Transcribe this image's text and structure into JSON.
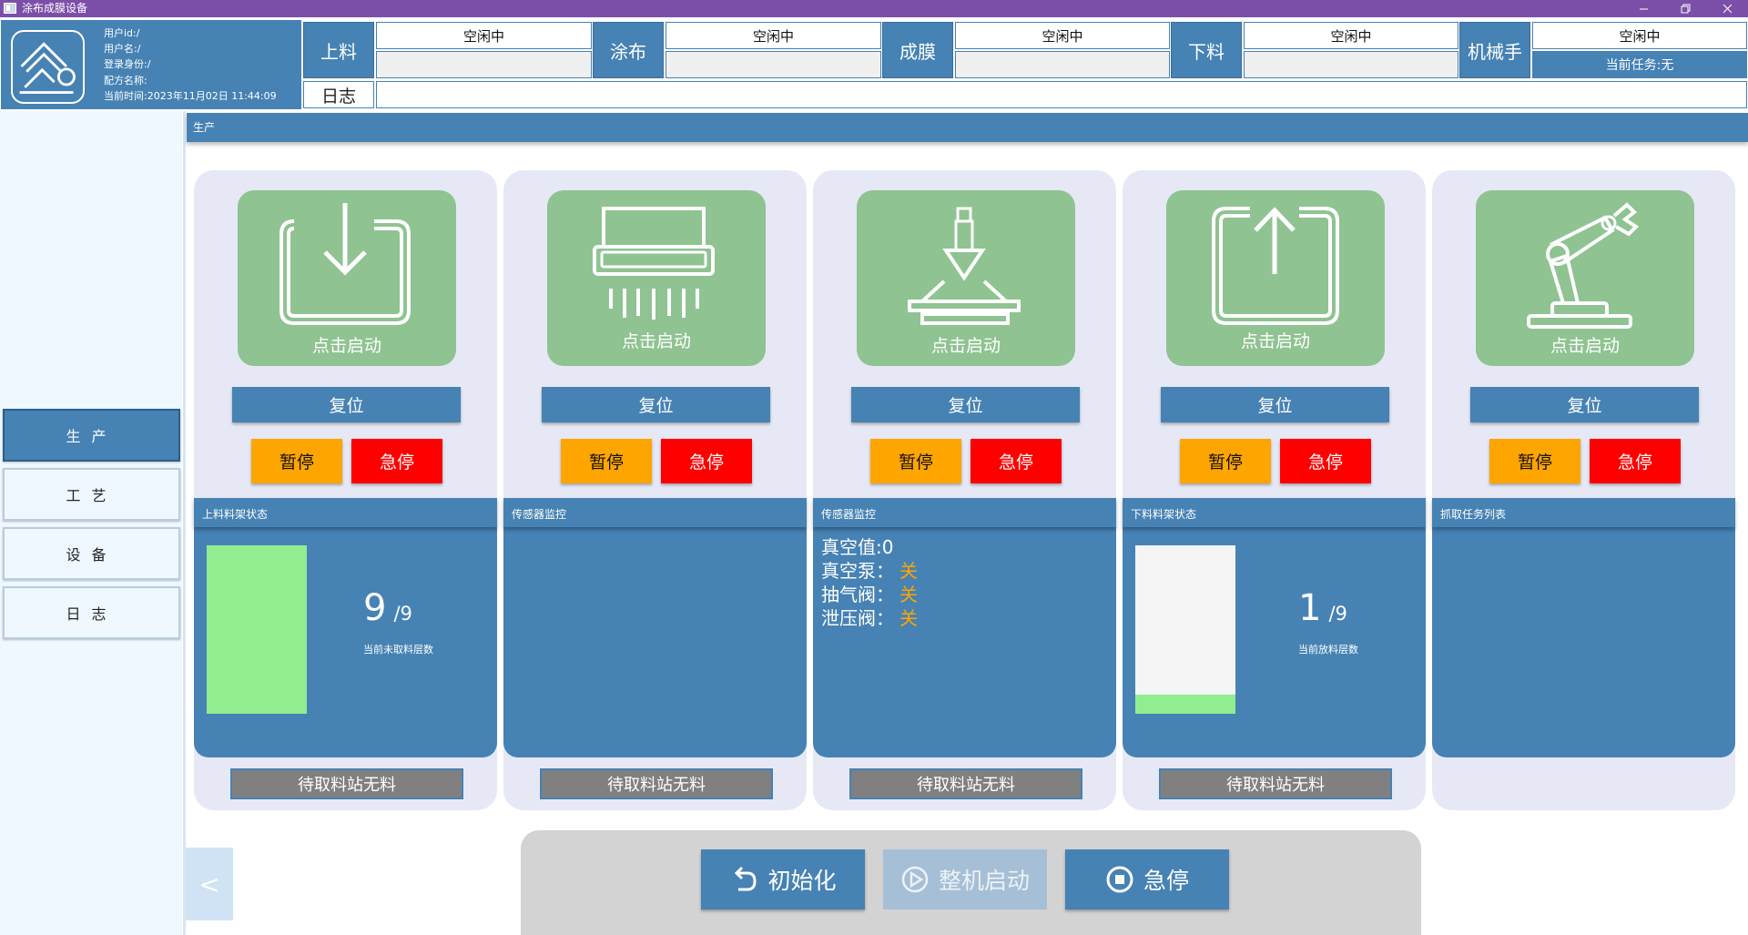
{
  "window": {
    "title": "涂布成膜设备",
    "controls": [
      "minimize-icon",
      "restore-icon",
      "close-icon"
    ]
  },
  "user": {
    "id": "用户id:/",
    "name": "用户名:/",
    "role": "登录身份:/",
    "recipe": "配方名称:",
    "time": "当前时间:2023年11月02日 11:44:09"
  },
  "stations": [
    {
      "label": "上料",
      "status": "空闲中",
      "sub": ""
    },
    {
      "label": "涂布",
      "status": "空闲中",
      "sub": ""
    },
    {
      "label": "成膜",
      "status": "空闲中",
      "sub": ""
    },
    {
      "label": "下料",
      "status": "空闲中",
      "sub": ""
    },
    {
      "label": "机械手",
      "status": "空闲中",
      "sub": "当前任务:无"
    }
  ],
  "log": {
    "label": "日志",
    "value": ""
  },
  "nav": [
    {
      "label": "生产",
      "active": true
    },
    {
      "label": "工艺",
      "active": false
    },
    {
      "label": "设备",
      "active": false
    },
    {
      "label": "日志",
      "active": false
    }
  ],
  "main": {
    "title": "生产"
  },
  "cards": [
    {
      "icon": "load-down-icon",
      "start": "点击启动",
      "reset": "复位",
      "pause": "暂停",
      "estop": "急停",
      "panel_title": "上料料架状态",
      "no_material": "待取料站无料"
    },
    {
      "icon": "coater-icon",
      "start": "点击启动",
      "reset": "复位",
      "pause": "暂停",
      "estop": "急停",
      "panel_title": "传感器监控",
      "no_material": "待取料站无料"
    },
    {
      "icon": "press-film-icon",
      "start": "点击启动",
      "reset": "复位",
      "pause": "暂停",
      "estop": "急停",
      "panel_title": "传感器监控",
      "no_material": "待取料站无料"
    },
    {
      "icon": "unload-up-icon",
      "start": "点击启动",
      "reset": "复位",
      "pause": "暂停",
      "estop": "急停",
      "panel_title": "下料料架状态",
      "no_material": "待取料站无料"
    },
    {
      "icon": "robot-arm-icon",
      "start": "点击启动",
      "reset": "复位",
      "pause": "暂停",
      "estop": "急停",
      "panel_title": "抓取任务列表"
    }
  ],
  "load_rack": {
    "count": "9",
    "total": "/9",
    "caption": "当前未取料层数",
    "fill_fraction": 1.0
  },
  "unload_rack": {
    "count": "1",
    "total": "/9",
    "caption": "当前放料层数",
    "fill_fraction": 0.1111
  },
  "film_sensors": [
    {
      "label": "真空值:0",
      "value": ""
    },
    {
      "label": "真空泵：",
      "value": "关"
    },
    {
      "label": "抽气阀：",
      "value": "关"
    },
    {
      "label": "泄压阀：",
      "value": "关"
    }
  ],
  "bottom": {
    "init": "初始化",
    "start": "整机启动",
    "stop": "急停",
    "collapse": "<"
  },
  "colors": {
    "titlebar": "#7b4fa8",
    "primary": "#4682b4",
    "tile": "#8fc391",
    "pause": "#ffa500",
    "estop": "#ff0000",
    "rack_fill": "#90ee90",
    "sensor_value": "#ffa500"
  }
}
